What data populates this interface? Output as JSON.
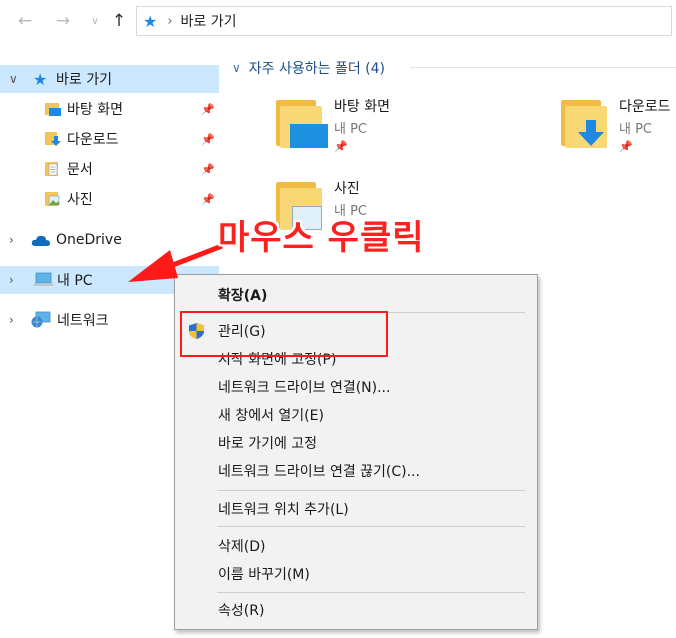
{
  "toolbar": {
    "address_path": "바로 가기"
  },
  "sidebar": {
    "quick_access": "바로 가기",
    "pinned": [
      {
        "label": "바탕 화면"
      },
      {
        "label": "다운로드"
      },
      {
        "label": "문서"
      },
      {
        "label": "사진"
      }
    ],
    "onedrive": "OneDrive",
    "this_pc": "내 PC",
    "network": "네트워크"
  },
  "main": {
    "group_title": "자주 사용하는 폴더 (4)",
    "folders": [
      {
        "name": "바탕 화면",
        "location": "내 PC"
      },
      {
        "name": "다운로드",
        "location": "내 PC"
      },
      {
        "name": "사진",
        "location": "내 PC"
      }
    ]
  },
  "annotation": {
    "text": "마우스 우클릭"
  },
  "context_menu": {
    "items": [
      {
        "label": "확장(A)"
      },
      {
        "label": "관리(G)"
      },
      {
        "label": "시작 화면에 고정(P)"
      },
      {
        "label": "네트워크 드라이브 연결(N)..."
      },
      {
        "label": "새 창에서 열기(E)"
      },
      {
        "label": "바로 가기에 고정"
      },
      {
        "label": "네트워크 드라이브 연결 끊기(C)..."
      },
      {
        "label": "네트워크 위치 추가(L)"
      },
      {
        "label": "삭제(D)"
      },
      {
        "label": "이름 바꾸기(M)"
      },
      {
        "label": "속성(R)"
      }
    ]
  },
  "colors": {
    "selection": "#cce8ff",
    "annotation": "#ff2020",
    "accent": "#1e88e5"
  }
}
